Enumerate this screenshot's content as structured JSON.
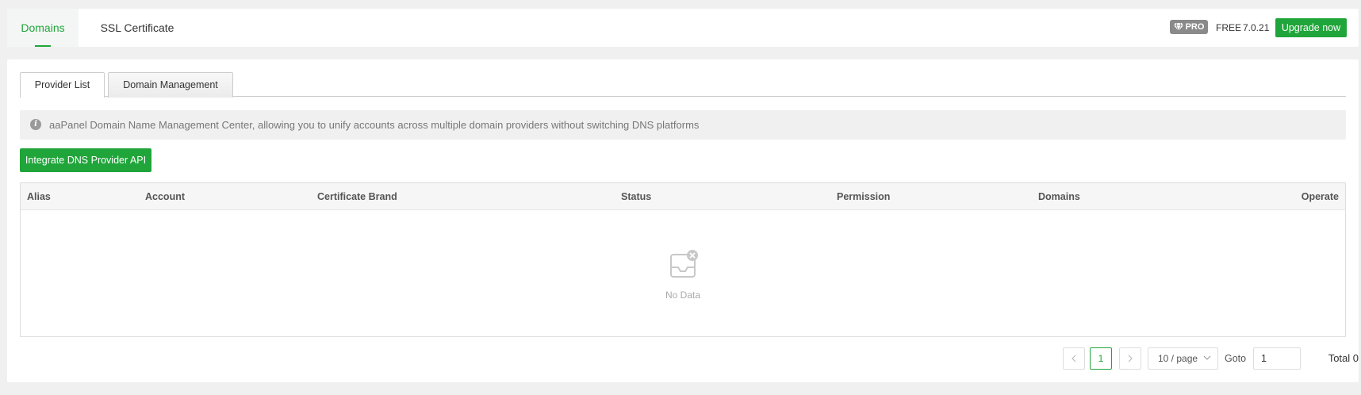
{
  "top_tabs": [
    {
      "label": "Domains",
      "active": true
    },
    {
      "label": "SSL Certificate",
      "active": false
    }
  ],
  "header": {
    "pro_badge": "PRO",
    "plan": "FREE",
    "version": "7.0.21",
    "upgrade_label": "Upgrade now"
  },
  "sub_tabs": [
    {
      "label": "Provider List",
      "active": true
    },
    {
      "label": "Domain Management",
      "active": false
    }
  ],
  "notice": "aaPanel Domain Name Management Center, allowing you to unify accounts across multiple domain providers without switching DNS platforms",
  "integrate_button": "Integrate DNS Provider API",
  "table": {
    "columns": [
      "Alias",
      "Account",
      "Certificate Brand",
      "Status",
      "Permission",
      "Domains",
      "Operate"
    ],
    "rows": [],
    "empty_text": "No Data"
  },
  "pagination": {
    "prev": "<",
    "current_page": "1",
    "next": ">",
    "page_size": "10 / page",
    "goto_label": "Goto",
    "goto_value": "1",
    "total": "Total 0"
  },
  "colors": {
    "accent": "#20a53a",
    "pro_badge_bg": "#8a8a8a",
    "notice_bg": "#f0f0f0"
  }
}
